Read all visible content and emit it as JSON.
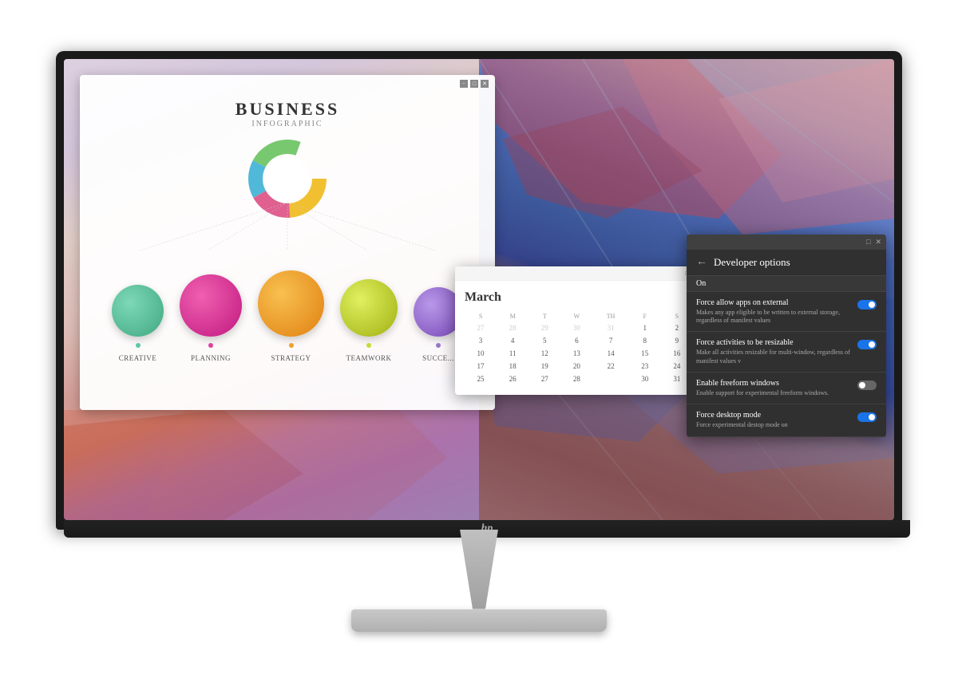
{
  "monitor": {
    "brand": "HP",
    "logo_text": "hp"
  },
  "infographic": {
    "title": "BUSINESS",
    "subtitle": "INFOGRAPHIC",
    "circles": [
      {
        "label": "CREATIVE",
        "color": "#5bc8a8",
        "size": 70,
        "dot_color": "#5bc8a8"
      },
      {
        "label": "PLANNING",
        "color": "#e0409a",
        "size": 80,
        "dot_color": "#e0409a"
      },
      {
        "label": "STRATEGY",
        "color": "#f0a030",
        "size": 85,
        "dot_color": "#f0a030"
      },
      {
        "label": "TEAMWORK",
        "color": "#c8d838",
        "size": 75,
        "dot_color": "#c8d838"
      },
      {
        "label": "SUCCESS",
        "color": "#9878c8",
        "size": 65,
        "dot_color": "#9878c8"
      }
    ]
  },
  "calendar": {
    "month": "March",
    "days_header": [
      "S",
      "M",
      "T",
      "W",
      "TH",
      "F",
      "S"
    ],
    "week1": [
      {
        "day": "27",
        "muted": true
      },
      {
        "day": "28",
        "muted": true
      },
      {
        "day": "29",
        "muted": true
      },
      {
        "day": "30",
        "muted": true
      },
      {
        "day": "31",
        "muted": true
      },
      {
        "day": "1"
      },
      {
        "day": "2"
      }
    ],
    "week2": [
      {
        "day": "3"
      },
      {
        "day": "4"
      },
      {
        "day": "5"
      },
      {
        "day": "6"
      },
      {
        "day": "7"
      },
      {
        "day": "8"
      },
      {
        "day": "9"
      }
    ],
    "week3": [
      {
        "day": "10"
      },
      {
        "day": "11"
      },
      {
        "day": "12"
      },
      {
        "day": "13"
      },
      {
        "day": "14"
      },
      {
        "day": "15"
      },
      {
        "day": "16"
      }
    ],
    "week4": [
      {
        "day": "17"
      },
      {
        "day": "18"
      },
      {
        "day": "19"
      },
      {
        "day": "20"
      },
      {
        "day": "22"
      },
      {
        "day": "23"
      },
      {
        "day": "24"
      }
    ],
    "week5": [
      {
        "day": "25"
      },
      {
        "day": "26"
      },
      {
        "day": "27"
      },
      {
        "day": "28"
      },
      {
        "day": "30"
      },
      {
        "day": "31"
      }
    ],
    "controls": [
      "□",
      "✕"
    ]
  },
  "developer_options": {
    "title": "Developer options",
    "status": "On",
    "settings": [
      {
        "title": "Force allow apps on external",
        "desc": "Makes any app eligible to be written to external storage, regardless of manifest values",
        "toggle": true
      },
      {
        "title": "Force activities to be resizable",
        "desc": "Make all activities resizable for multi-window, regardless of manifest values v",
        "toggle": true
      },
      {
        "title": "Enable freeform windows",
        "desc": "Enable support for experimental freeform windows.",
        "toggle": false
      },
      {
        "title": "Force desktop mode",
        "desc": "Force experimental destop mode on",
        "toggle": true
      }
    ],
    "controls": [
      "□",
      "✕"
    ]
  }
}
